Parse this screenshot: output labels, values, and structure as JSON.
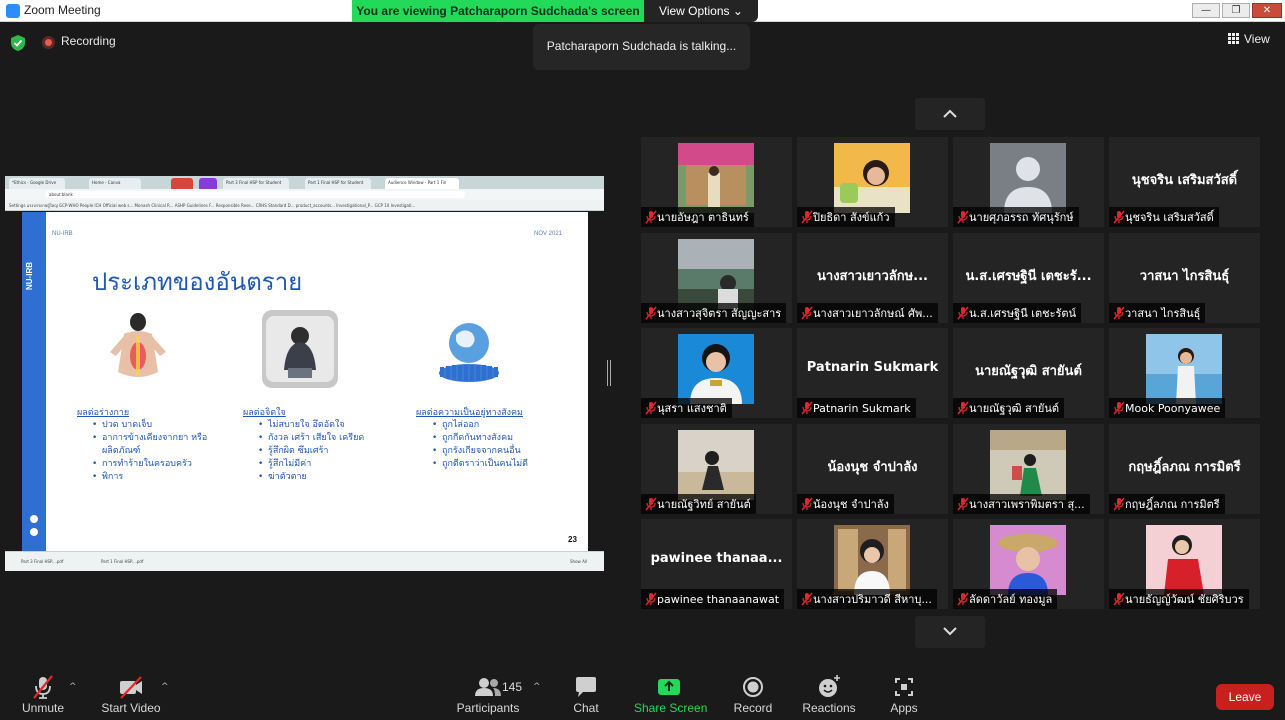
{
  "window": {
    "title": "Zoom Meeting",
    "min": "—",
    "max": "❐",
    "close": "✕"
  },
  "banner": {
    "text": "You are viewing Patcharaporn Sudchada's screen",
    "view_options": "View Options",
    "view_options_caret": "⌄"
  },
  "status": {
    "recording": "Recording",
    "talking": "Patcharaporn Sudchada is talking...",
    "view": "View"
  },
  "shared_screen": {
    "tabs": [
      "*Ethics - Google Drive",
      "Home - Canva",
      "Part 3 Final HSP for Student",
      "Part 1 Final HSP for Student",
      "Audience Window - Part 1 Fin"
    ],
    "url": "about:blank",
    "bookmarks": "Settings  แรงบรรดายผู้ใหญ่  GCP-WHO People  ICH Official web s...  Monash Clinical R...  ASHP Guidelines F...  Responsible Rese...  CRHS Standard D...  product_accounts...  Investigational_P...  GCP 10 Investigati...",
    "downloads": [
      "Part 3 Final HSP....pdf",
      "Part 1 Final HSP....pdf"
    ],
    "downloads_show_all": "Show All",
    "slide": {
      "side_label": "NU-IRB",
      "header_left": "NU-IRB",
      "header_right": "NOV 2021",
      "title": "ประเภทของอันตราย",
      "page_number": "23",
      "columns": [
        {
          "heading": "ผลต่อร่างกาย",
          "items": [
            "ปวด บาดเจ็บ",
            "อาการข้างเคียงจากยา หรือผลิตภัณฑ์",
            "การทำร้ายในครอบครัว",
            "พิการ"
          ]
        },
        {
          "heading": "ผลต่อจิตใจ",
          "items": [
            "ไม่สบายใจ อึดอัดใจ",
            "กังวล เศร้า เสียใจ เครียด",
            "รู้สึกผิด ซึมเศร้า",
            "รู้สึกไม่มีค่า",
            "ฆ่าตัวตาย"
          ]
        },
        {
          "heading": "ผลต่อความเป็นอยู่ทางสังคม",
          "items": [
            "ถูกไล่ออก",
            "ถูกกีดกันทางสังคม",
            "ถูกรังเกียจจากคนอื่น",
            "ถูกตีตราว่าเป็นคนไม่ดี"
          ]
        }
      ]
    }
  },
  "participants": [
    {
      "name": "นายอัษฎา ตาธินทร์",
      "big": "",
      "photo": "pic-building"
    },
    {
      "name": "ปิยธิดา สังข์แก้ว",
      "big": "",
      "photo": "pic-girl-yellow"
    },
    {
      "name": "นายศุภอรรถ ทัศนุรักษ์",
      "big": "",
      "photo": "avatar-default"
    },
    {
      "name": "นุชจริน เสริมสวัสดิ์",
      "big": "นุชจริน เสริมสวัสดิ์",
      "photo": ""
    },
    {
      "name": "นางสาวสุจิตรา สัญญะสาร",
      "big": "",
      "photo": "pic-sunset"
    },
    {
      "name": "นางสาวเยาวลักษณ์ ศัพ...",
      "big": "นางสาวเยาวลักษ...",
      "photo": ""
    },
    {
      "name": "น.ส.เศรษฐินี  เตชะรัตน์",
      "big": "น.ส.เศรษฐินี  เตชะรั...",
      "photo": ""
    },
    {
      "name": "วาสนา ไกรสินธุ์",
      "big": "วาสนา ไกรสินธุ์",
      "photo": ""
    },
    {
      "name": "นุสรา แสงชาติ",
      "big": "",
      "photo": "pic-uniform"
    },
    {
      "name": "Patnarin Sukmark",
      "big": "Patnarin Sukmark",
      "photo": ""
    },
    {
      "name": "นายณัฐวุฒิ สายันต์",
      "big": "นายณัฐวุฒิ สายันต์",
      "photo": ""
    },
    {
      "name": "Mook Poonyawee",
      "big": "",
      "photo": "pic-beach"
    },
    {
      "name": "นายณัฐวิทย์ สายันต์",
      "big": "",
      "photo": "pic-sand"
    },
    {
      "name": "น้องนุช จำปาลัง",
      "big": "น้องนุช จำปาลัง",
      "photo": ""
    },
    {
      "name": "นางสาวเพราพิมตรา สุ...",
      "big": "",
      "photo": "pic-dancer"
    },
    {
      "name": "กฤษฎิ์ลภณ การมิตรี",
      "big": "กฤษฎิ์ลภณ การมิตรี",
      "photo": ""
    },
    {
      "name": "pawinee thanaanawat",
      "big": "pawinee  thanaa...",
      "photo": ""
    },
    {
      "name": "นางสาวปริมาวดี สีหาบุ...",
      "big": "",
      "photo": "pic-bookshelf"
    },
    {
      "name": "ลัดดาวัลย์ ทองมูล",
      "big": "",
      "photo": "pic-hat"
    },
    {
      "name": "นายธัญญ์วัฒน์ ชัยศิริบวร",
      "big": "",
      "photo": "pic-red-dress"
    }
  ],
  "toolbar": {
    "unmute": "Unmute",
    "start_video": "Start Video",
    "participants": "Participants",
    "participant_count": "145",
    "chat": "Chat",
    "share_screen": "Share Screen",
    "record": "Record",
    "reactions": "Reactions",
    "apps": "Apps",
    "leave": "Leave",
    "caret": "^"
  },
  "colors": {
    "share_green": "#23d959",
    "leave_red": "#c8201f",
    "tile_bg": "#242424",
    "slide_blue": "#1f57b5",
    "mic_off_red": "#e02828"
  }
}
